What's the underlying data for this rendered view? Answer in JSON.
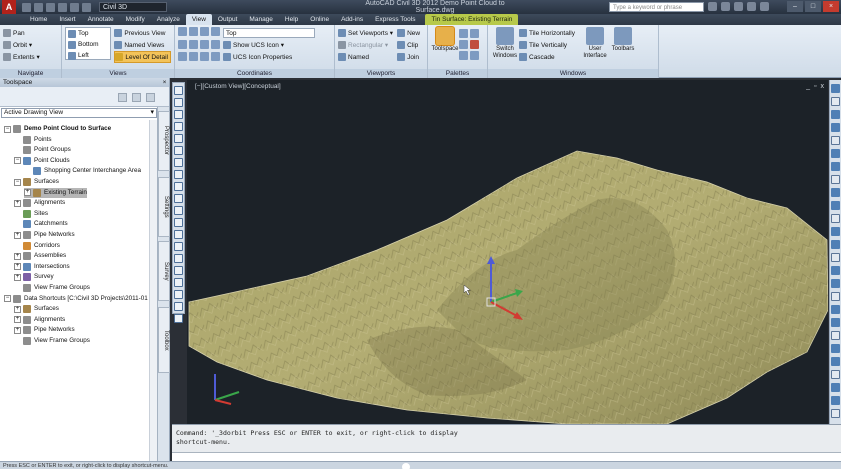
{
  "titlebar": {
    "app_logo": "A",
    "workspace": "Civil 3D",
    "window_title": "AutoCAD Civil 3D 2012   Demo Point Cloud to Surface.dwg",
    "search_placeholder": "Type a keyword or phrase"
  },
  "tabs": [
    "Home",
    "Insert",
    "Annotate",
    "Modify",
    "Analyze",
    "View",
    "Output",
    "Manage",
    "Help",
    "Online",
    "Add-ins",
    "Express Tools"
  ],
  "active_tab": "View",
  "context_tab": "Tin Surface: Existing Terrain",
  "ribbon": {
    "navigate": {
      "title": "Navigate",
      "pan": "Pan",
      "orbit": "Orbit",
      "extents": "Extents"
    },
    "views": {
      "title": "Views",
      "list": [
        "Top",
        "Bottom",
        "Left"
      ],
      "previous": "Previous View",
      "named": "Named Views",
      "lod": "Level Of Detail"
    },
    "coordinates": {
      "title": "Coordinates",
      "top": "Top",
      "show_ucs": "Show UCS Icon",
      "ucs_props": "UCS Icon Properties"
    },
    "viewports": {
      "title": "Viewports",
      "set": "Set Viewports",
      "rect": "Rectangular",
      "named": "Named",
      "new": "New",
      "clip": "Clip",
      "join": "Join"
    },
    "palettes": {
      "title": "Palettes",
      "toolspace": "Toolspace"
    },
    "windows": {
      "title": "Windows",
      "switch": "Switch Windows",
      "horiz": "Tile Horizontally",
      "vert": "Tile Vertically",
      "cascade": "Cascade",
      "user_interface": "User Interface",
      "toolbars": "Toolbars"
    }
  },
  "toolspace": {
    "title": "Toolspace",
    "view": "Active Drawing View",
    "tree": [
      {
        "label": "Demo Point Cloud to Surface",
        "level": 0,
        "expander": "−",
        "icon": "drawing",
        "bold": true
      },
      {
        "label": "Points",
        "level": 1,
        "icon": "points"
      },
      {
        "label": "Point Groups",
        "level": 1,
        "icon": "points"
      },
      {
        "label": "Point Clouds",
        "level": 1,
        "expander": "−",
        "icon": "cloud"
      },
      {
        "label": "Shopping Center Interchange Area",
        "level": 2,
        "icon": "cloud"
      },
      {
        "label": "Surfaces",
        "level": 1,
        "expander": "−",
        "icon": "surface"
      },
      {
        "label": "Existing Terrain",
        "level": 2,
        "expander": "+",
        "icon": "surface",
        "selected": true
      },
      {
        "label": "Alignments",
        "level": 1,
        "expander": "+",
        "icon": "align"
      },
      {
        "label": "Sites",
        "level": 1,
        "icon": "site"
      },
      {
        "label": "Catchments",
        "level": 1,
        "icon": "catch"
      },
      {
        "label": "Pipe Networks",
        "level": 1,
        "expander": "+",
        "icon": "pipe"
      },
      {
        "label": "Corridors",
        "level": 1,
        "icon": "corridor"
      },
      {
        "label": "Assemblies",
        "level": 1,
        "expander": "+",
        "icon": "assembly"
      },
      {
        "label": "Intersections",
        "level": 1,
        "expander": "+",
        "icon": "intersect"
      },
      {
        "label": "Survey",
        "level": 1,
        "expander": "+",
        "icon": "survey"
      },
      {
        "label": "View Frame Groups",
        "level": 1,
        "icon": "frame"
      },
      {
        "label": "Data Shortcuts [C:\\Civil 3D Projects\\2011-01 ...",
        "level": 0,
        "expander": "−",
        "icon": "shortcut"
      },
      {
        "label": "Surfaces",
        "level": 1,
        "expander": "+",
        "icon": "surface"
      },
      {
        "label": "Alignments",
        "level": 1,
        "expander": "+",
        "icon": "align"
      },
      {
        "label": "Pipe Networks",
        "level": 1,
        "expander": "+",
        "icon": "pipe"
      },
      {
        "label": "View Frame Groups",
        "level": 1,
        "icon": "frame"
      }
    ],
    "vtabs": [
      "Prospector",
      "Settings",
      "Survey",
      "Toolbox"
    ]
  },
  "viewport": {
    "label": "[−][Custom View][Conceptual]",
    "controls": [
      "_",
      "▫",
      "x"
    ]
  },
  "command_line": {
    "history": [
      "Command: '_3dorbit Press ESC or ENTER to exit, or right-click to display",
      "shortcut-menu."
    ],
    "input": ""
  },
  "status_bar": "Press ESC or ENTER to exit, or right-click to display shortcut-menu.",
  "colors": {
    "terrain": "#b0a870",
    "viewport_bg": "#1c2228",
    "context_tab": "#b7c94a"
  }
}
